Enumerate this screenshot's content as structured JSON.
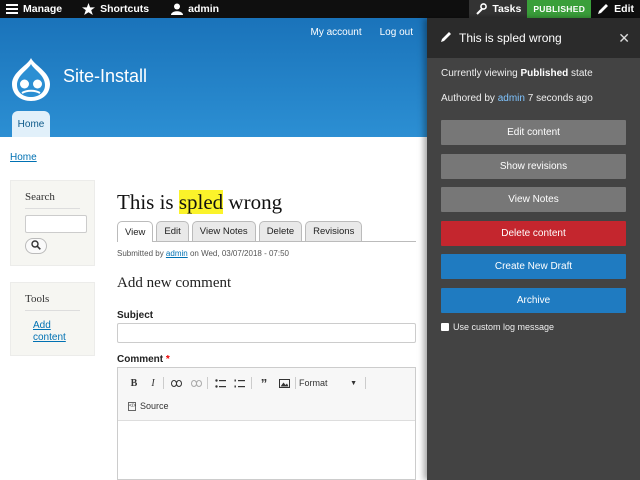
{
  "toolbar": {
    "manage_label": "Manage",
    "shortcuts_label": "Shortcuts",
    "user_label": "admin",
    "tasks_label": "Tasks",
    "published_badge": "PUBLISHED",
    "edit_label": "Edit"
  },
  "header": {
    "my_account": "My account",
    "log_out": "Log out",
    "site_name": "Site-Install",
    "home_tab": "Home"
  },
  "breadcrumb": {
    "home": "Home"
  },
  "sidebar": {
    "search_title": "Search",
    "tools_title": "Tools",
    "add_content_link": "Add content"
  },
  "node": {
    "title_before": "This is ",
    "title_highlight": "spled",
    "title_after": " wrong",
    "tabs": [
      "View",
      "Edit",
      "View Notes",
      "Delete",
      "Revisions"
    ],
    "submitted_prefix": "Submitted by ",
    "submitted_author": "admin",
    "submitted_suffix": " on Wed, 03/07/2018 - 07:50"
  },
  "comment_form": {
    "heading": "Add new comment",
    "subject_label": "Subject",
    "comment_label": "Comment",
    "required_mark": "*",
    "format_label": "Format",
    "source_label": "Source"
  },
  "tray": {
    "title": "This is spled wrong",
    "viewing_prefix": "Currently viewing ",
    "viewing_state": "Published",
    "viewing_suffix": " state",
    "authored_prefix": "Authored by ",
    "authored_user": "admin",
    "authored_suffix": " 7 seconds ago",
    "buttons": [
      "Edit content",
      "Show revisions",
      "View Notes",
      "Delete content",
      "Create New Draft",
      "Archive"
    ],
    "log_message_label": "Use custom log message"
  },
  "colors": {
    "toolbar_bg": "#0f0f0f",
    "header_blue": "#1a73ba",
    "published_green": "#3a9f3a",
    "tray_bg": "#434343",
    "danger_red": "#c4262e",
    "primary_blue": "#1f7bc1",
    "highlight_yellow": "#fbf32a"
  }
}
